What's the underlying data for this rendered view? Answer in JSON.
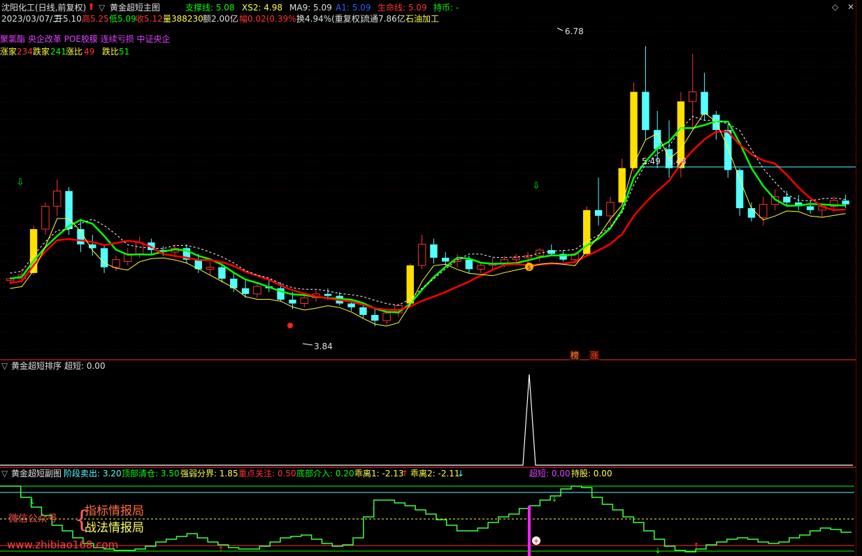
{
  "header": {
    "stock": "沈阳化工(日线,前复权)",
    "main_indicator": "黄金超短主图",
    "support_line": "支撑线: 5.08",
    "xs2": "XS2: 4.98",
    "ma9": "MA9: 5.09",
    "a1": "A1: 5.09",
    "life_line": "生命线: 5.09",
    "hold_coin": "持币: -"
  },
  "quote": {
    "date": "2023/03/07/二",
    "open": "开5.10",
    "high": "高5.25",
    "low": "低5.09",
    "close": "收5.12",
    "volume": "量388230",
    "amount": "额2.00亿",
    "change": "幅0.02(0.39%)",
    "turnover": "换4.94%(重复权)",
    "float": "流通7.86亿",
    "industry": "石油加工"
  },
  "concept_tags": "聚氯酯 央企改革 POE胶膜 连续亏损 中证央企",
  "breadth": {
    "up_label": "涨家",
    "up_value": "234",
    "down_label": "跌家",
    "down_value": "241",
    "ratio_label": "涨比",
    "ratio_value": "49",
    "fall_label": "跌比",
    "fall_value": "51"
  },
  "price_labels": {
    "high_mark": "6.78",
    "low_mark": "3.84",
    "level_a": "5.49",
    "level_b": "5.48"
  },
  "badges": {
    "badge1": "榜",
    "badge2": "涨"
  },
  "pane2": {
    "title": "黄金超短排序",
    "value": "超短: 0.00"
  },
  "pane3": {
    "title": "黄金超短副图",
    "stage_sell": "阶段卖出: 3.20",
    "top_clear": "顶部清仓: 3.50",
    "strong_weak": "强弱分界: 1.85",
    "focus": "重点关注: 0.50",
    "bottom_entry": "底部介入: 0.20",
    "deviation1": "乖离1: -2.13",
    "deviation2": "乖离2: -2.11",
    "super_short": "超短: 0.00",
    "hold": "持股: 0.00"
  },
  "watermark": {
    "wechat": "微信公众号",
    "line1": "指标情报局",
    "line2": "战法情报局",
    "site": "www.zhibiao168.com"
  },
  "colors": {
    "up": "#ff3232",
    "down": "#54ffff",
    "ma_green": "#00ff00",
    "life_red": "#ff0000",
    "yellow_bar": "#ffe000"
  },
  "chart_data": {
    "type": "candlestick",
    "ylim": [
      3.6,
      7.0
    ],
    "candles": [
      [
        4.32,
        4.36,
        4.28,
        4.34
      ],
      [
        4.34,
        4.44,
        4.3,
        4.38
      ],
      [
        4.4,
        4.9,
        4.38,
        4.86
      ],
      [
        4.86,
        5.14,
        4.8,
        5.1
      ],
      [
        5.1,
        5.38,
        5.0,
        5.26
      ],
      [
        5.26,
        5.3,
        4.8,
        4.86
      ],
      [
        4.86,
        4.95,
        4.62,
        4.7
      ],
      [
        4.7,
        4.8,
        4.58,
        4.66
      ],
      [
        4.66,
        4.7,
        4.4,
        4.46
      ],
      [
        4.46,
        4.58,
        4.42,
        4.54
      ],
      [
        4.52,
        4.66,
        4.48,
        4.6
      ],
      [
        4.6,
        4.78,
        4.56,
        4.72
      ],
      [
        4.72,
        4.76,
        4.6,
        4.64
      ],
      [
        4.64,
        4.68,
        4.58,
        4.62
      ],
      [
        4.62,
        4.7,
        4.58,
        4.66
      ],
      [
        4.66,
        4.7,
        4.5,
        4.54
      ],
      [
        4.54,
        4.6,
        4.4,
        4.44
      ],
      [
        4.44,
        4.52,
        4.38,
        4.46
      ],
      [
        4.46,
        4.5,
        4.3,
        4.34
      ],
      [
        4.34,
        4.4,
        4.2,
        4.24
      ],
      [
        4.24,
        4.32,
        4.14,
        4.18
      ],
      [
        4.18,
        4.3,
        4.14,
        4.26
      ],
      [
        4.26,
        4.34,
        4.2,
        4.24
      ],
      [
        4.24,
        4.3,
        4.1,
        4.12
      ],
      [
        4.12,
        4.2,
        4.02,
        4.08
      ],
      [
        4.08,
        4.16,
        4.04,
        4.14
      ],
      [
        4.14,
        4.22,
        4.1,
        4.18
      ],
      [
        4.18,
        4.24,
        4.12,
        4.16
      ],
      [
        4.16,
        4.2,
        4.06,
        4.08
      ],
      [
        4.08,
        4.12,
        4.0,
        4.04
      ],
      [
        4.04,
        4.08,
        3.92,
        3.96
      ],
      [
        3.96,
        4.02,
        3.84,
        3.9
      ],
      [
        3.9,
        4.0,
        3.86,
        3.98
      ],
      [
        3.98,
        4.08,
        3.94,
        4.06
      ],
      [
        4.08,
        4.5,
        4.06,
        4.48
      ],
      [
        4.48,
        4.8,
        4.44,
        4.7
      ],
      [
        4.7,
        4.76,
        4.5,
        4.56
      ],
      [
        4.56,
        4.62,
        4.48,
        4.52
      ],
      [
        4.52,
        4.6,
        4.46,
        4.54
      ],
      [
        4.54,
        4.58,
        4.4,
        4.44
      ],
      [
        4.44,
        4.52,
        4.4,
        4.48
      ],
      [
        4.48,
        4.56,
        4.44,
        4.5
      ],
      [
        4.5,
        4.58,
        4.46,
        4.54
      ],
      [
        4.54,
        4.6,
        4.48,
        4.56
      ],
      [
        4.56,
        4.62,
        4.5,
        4.58
      ],
      [
        4.58,
        4.66,
        4.52,
        4.64
      ],
      [
        4.64,
        4.7,
        4.58,
        4.6
      ],
      [
        4.6,
        4.64,
        4.52,
        4.54
      ],
      [
        4.54,
        4.62,
        4.5,
        4.6
      ],
      [
        4.6,
        5.1,
        4.58,
        5.06
      ],
      [
        5.06,
        5.4,
        4.9,
        5.0
      ],
      [
        5.0,
        5.2,
        4.9,
        5.14
      ],
      [
        5.14,
        5.6,
        5.1,
        5.5
      ],
      [
        5.5,
        6.4,
        5.46,
        6.3
      ],
      [
        6.3,
        6.78,
        5.8,
        5.9
      ],
      [
        5.9,
        6.1,
        5.5,
        5.7
      ],
      [
        5.7,
        6.0,
        5.4,
        5.5
      ],
      [
        5.5,
        6.3,
        5.4,
        6.2
      ],
      [
        6.2,
        6.7,
        5.9,
        6.3
      ],
      [
        6.3,
        6.5,
        6.0,
        6.06
      ],
      [
        6.06,
        6.1,
        5.8,
        5.9
      ],
      [
        5.9,
        5.96,
        5.4,
        5.48
      ],
      [
        5.48,
        5.5,
        5.0,
        5.08
      ],
      [
        5.08,
        5.14,
        4.94,
        4.98
      ],
      [
        4.98,
        5.2,
        4.9,
        5.12
      ],
      [
        5.12,
        5.28,
        5.06,
        5.2
      ],
      [
        5.2,
        5.26,
        5.1,
        5.14
      ],
      [
        5.14,
        5.22,
        5.06,
        5.1
      ],
      [
        5.1,
        5.16,
        5.02,
        5.06
      ],
      [
        5.06,
        5.12,
        4.98,
        5.1
      ],
      [
        5.1,
        5.2,
        5.04,
        5.16
      ],
      [
        5.16,
        5.22,
        5.08,
        5.12
      ]
    ]
  }
}
